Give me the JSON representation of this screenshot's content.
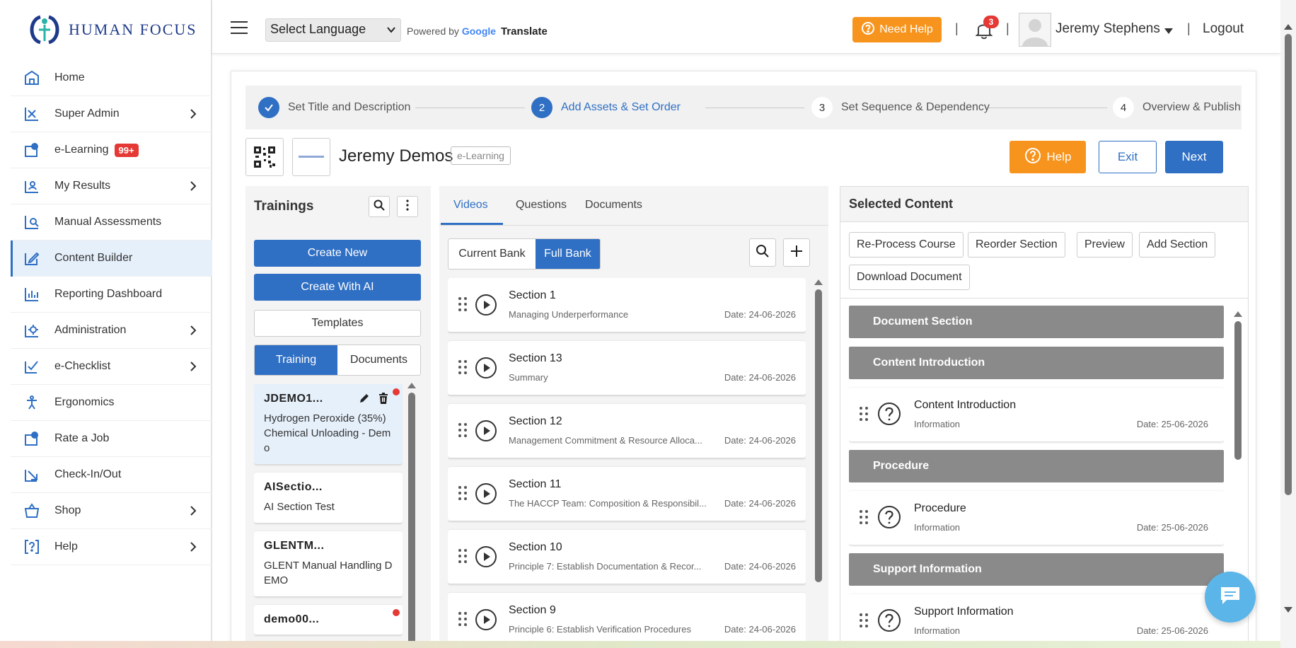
{
  "brand": {
    "name": "HUMAN FOCUS"
  },
  "sidebar": {
    "items": [
      {
        "label": "Home",
        "icon": "home-icon",
        "has_chevron": false
      },
      {
        "label": "Super Admin",
        "icon": "admin-icon",
        "has_chevron": true
      },
      {
        "label": "e-Learning",
        "icon": "elearning-icon",
        "has_chevron": false,
        "badge": "99+"
      },
      {
        "label": "My Results",
        "icon": "results-icon",
        "has_chevron": true
      },
      {
        "label": "Manual Assessments",
        "icon": "assessment-icon",
        "has_chevron": false
      },
      {
        "label": "Content Builder",
        "icon": "edit-icon",
        "has_chevron": false,
        "active": true
      },
      {
        "label": "Reporting Dashboard",
        "icon": "chart-icon",
        "has_chevron": false
      },
      {
        "label": "Administration",
        "icon": "settings-icon",
        "has_chevron": true
      },
      {
        "label": "e-Checklist",
        "icon": "checklist-icon",
        "has_chevron": true
      },
      {
        "label": "Ergonomics",
        "icon": "ergonomics-icon",
        "has_chevron": false
      },
      {
        "label": "Rate a Job",
        "icon": "rate-icon",
        "has_chevron": false
      },
      {
        "label": "Check-In/Out",
        "icon": "checkin-icon",
        "has_chevron": false
      },
      {
        "label": "Shop",
        "icon": "shop-icon",
        "has_chevron": true
      },
      {
        "label": "Help",
        "icon": "help-icon",
        "has_chevron": true
      }
    ]
  },
  "topbar": {
    "language_placeholder": "Select Language",
    "powered_by": "Powered by",
    "google": "Google",
    "translate": "Translate",
    "need_help": "Need Help",
    "notifications_count": "3",
    "user_name": "Jeremy Stephens",
    "logout": "Logout"
  },
  "stepper": {
    "steps": [
      {
        "number": "1",
        "label": "Set Title and Description",
        "state": "done"
      },
      {
        "number": "2",
        "label": "Add Assets & Set Order",
        "state": "current"
      },
      {
        "number": "3",
        "label": "Set Sequence & Dependency",
        "state": "todo"
      },
      {
        "number": "4",
        "label": "Overview & Publish",
        "state": "todo"
      }
    ]
  },
  "course": {
    "title": "Jeremy Demos",
    "type": "e-Learning",
    "help": "Help",
    "exit": "Exit",
    "next": "Next"
  },
  "trainings": {
    "title": "Trainings",
    "create_new": "Create New",
    "create_ai": "Create With AI",
    "templates": "Templates",
    "tab_training": "Training",
    "tab_documents": "Documents",
    "items": [
      {
        "code": "JDEMO1...",
        "name": "Hydrogen Peroxide (35%) Chemical Unloading - Demo",
        "selected": true,
        "dot": true
      },
      {
        "code": "AISectio...",
        "name": "AI Section Test",
        "selected": false,
        "dot": false
      },
      {
        "code": "GLENTM...",
        "name": "GLENT Manual Handling DEMO",
        "selected": false,
        "dot": false
      },
      {
        "code": "demo00...",
        "name": "",
        "selected": false,
        "dot": true
      }
    ]
  },
  "videos": {
    "tabs": [
      "Videos",
      "Questions",
      "Documents"
    ],
    "bank_current": "Current Bank",
    "bank_full": "Full Bank",
    "items": [
      {
        "title": "Section 1",
        "subtitle": "Managing Underperformance",
        "date": "Date: 24-06-2026"
      },
      {
        "title": "Section 13",
        "subtitle": "Summary",
        "date": "Date: 24-06-2026"
      },
      {
        "title": "Section 12",
        "subtitle": "Management Commitment & Resource Alloca...",
        "date": "Date: 24-06-2026"
      },
      {
        "title": "Section 11",
        "subtitle": "The HACCP Team: Composition & Responsibil...",
        "date": "Date: 24-06-2026"
      },
      {
        "title": "Section 10",
        "subtitle": "Principle 7: Establish Documentation & Recor...",
        "date": "Date: 24-06-2026"
      },
      {
        "title": "Section 9",
        "subtitle": "Principle 6: Establish Verification Procedures",
        "date": "Date: 24-06-2026"
      }
    ]
  },
  "selected_content": {
    "title": "Selected Content",
    "buttons": [
      "Re-Process Course",
      "Reorder Section",
      "Preview",
      "Add Section",
      "Download Document"
    ],
    "sections": {
      "s1": "Document Section",
      "s2": "Content Introduction",
      "s3": "Procedure",
      "s4": "Support Information"
    },
    "cards": {
      "c1": {
        "title": "Content Introduction",
        "subtitle": "Information",
        "date": "Date: 25-06-2026"
      },
      "c2": {
        "title": "Procedure",
        "subtitle": "Information",
        "date": "Date: 25-06-2026"
      },
      "c3": {
        "title": "Support Information",
        "subtitle": "Information",
        "date": "Date: 25-06-2026"
      }
    }
  },
  "colors": {
    "primary": "#2f6fc4",
    "orange": "#f7941d",
    "red": "#e53935",
    "section_gray": "#8a8a8a"
  }
}
